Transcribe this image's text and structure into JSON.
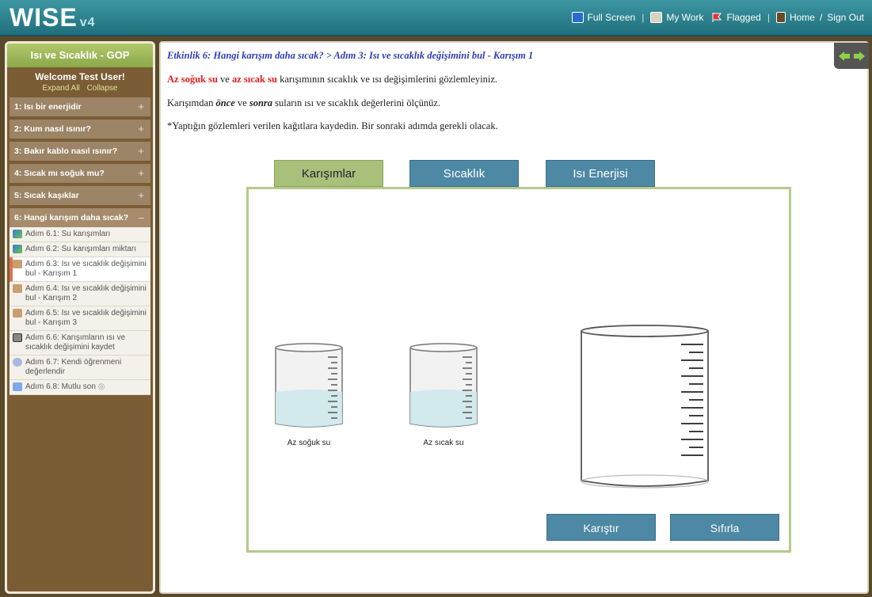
{
  "header": {
    "logo": "WISE",
    "version": "v4",
    "nav": {
      "full_screen": "Full Screen",
      "my_work": "My Work",
      "flagged": "Flagged",
      "home": "Home",
      "sign_out": "Sign Out",
      "separator": "/"
    }
  },
  "sidebar": {
    "title": "Isı ve Sıcaklık - GOP",
    "welcome": "Welcome Test User!",
    "expand_all": "Expand All",
    "collapse": "Collapse",
    "activities": [
      {
        "label": "1: Isı bir enerjidir",
        "toggle": "+"
      },
      {
        "label": "2: Kum nasıl ısınır?",
        "toggle": "+"
      },
      {
        "label": "3: Bakır kablo nasıl ısınır?",
        "toggle": "+"
      },
      {
        "label": "4: Sıcak mı soğuk mu?",
        "toggle": "+"
      },
      {
        "label": "5: Sıcak kaşıklar",
        "toggle": "+"
      },
      {
        "label": "6: Hangi karışım daha sıcak?",
        "toggle": "–"
      }
    ],
    "steps": [
      {
        "label": "Adım 6.1: Su karışımları",
        "icon": "annotator-icon"
      },
      {
        "label": "Adım 6.2: Su karışımları miktarı",
        "icon": "annotator-icon"
      },
      {
        "label": "Adım 6.3: Isı ve sıcaklık değişimini bul - Karışım 1",
        "icon": "simulation-icon"
      },
      {
        "label": "Adım 6.4: Isı ve sıcaklık değişimini bul - Karışım 2",
        "icon": "simulation-icon"
      },
      {
        "label": "Adım 6.5: Isı ve sıcaklık değişimini bul - Karışım 3",
        "icon": "simulation-icon"
      },
      {
        "label": "Adım 6.6: Karışımların ısı ve sıcaklık değişimini kaydet",
        "icon": "table-icon"
      },
      {
        "label": "Adım 6.7: Kendi öğrenmeni değerlendir",
        "icon": "reflection-icon"
      },
      {
        "label": "Adım 6.8: Mutlu son",
        "icon": "network-icon"
      }
    ]
  },
  "main": {
    "step_title": "Etkinlik 6: Hangi karışım daha sıcak? > Adım 3: Isı ve sıcaklık değişimini bul - Karışım 1",
    "line1": {
      "cold": "Az soğuk su",
      "and": " ve ",
      "hot": "az sıcak su",
      "rest": " karışımının sıcaklık ve ısı değişimlerini gözlemleyiniz."
    },
    "line2": {
      "pre": "Karışımdan ",
      "before": "önce",
      "and": " ve ",
      "after": "sonra",
      "rest": " suların ısı ve sıcaklık değerlerini ölçünüz."
    },
    "line3": "*Yaptığın gözlemleri verilen kağıtlara kaydedin. Bir sonraki adımda gerekli olacak.",
    "sim": {
      "tabs": [
        "Karışımlar",
        "Sıcaklık",
        "Isı Enerjisi"
      ],
      "beaker1_label": "Az soğuk su",
      "beaker2_label": "Az sıcak su",
      "mix_button": "Karıştır",
      "reset_button": "Sıfırla"
    }
  },
  "colors": {
    "accent": "#4d88a4",
    "header": "#2a8390",
    "sidebar": "#7a5c35",
    "highlight": "#e02020",
    "title": "#2c3fb4"
  }
}
